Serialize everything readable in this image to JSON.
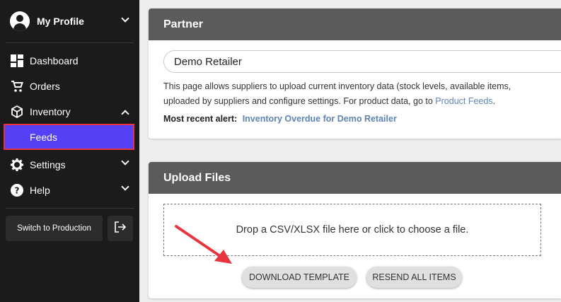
{
  "sidebar": {
    "profile_label": "My Profile",
    "nav": {
      "dashboard": "Dashboard",
      "orders": "Orders",
      "inventory": "Inventory",
      "feeds": "Feeds",
      "settings": "Settings",
      "help": "Help"
    },
    "switch_label": "Switch to Production"
  },
  "partner": {
    "header": "Partner",
    "selected": "Demo Retailer",
    "desc_line1": "This page allows suppliers to upload current inventory data (stock levels, available items,",
    "desc_line2": "uploaded by suppliers and configure settings. For product data, go to",
    "desc_link": "Product Feeds",
    "desc_end": ".",
    "alert_label": "Most recent alert:",
    "alert_link": "Inventory Overdue for Demo Retailer"
  },
  "upload": {
    "header": "Upload Files",
    "dropzone_text": "Drop a CSV/XLSX file here or click to choose a file.",
    "download_label": "DOWNLOAD TEMPLATE",
    "resend_label": "RESEND ALL ITEMS"
  },
  "colors": {
    "sidebar_bg": "#1b1b1b",
    "feeds_active": "#5540f6",
    "highlight_border": "#e8343f",
    "card_header": "#5b5b5b",
    "link": "#5d84b6",
    "annotation_arrow": "#e8343f"
  },
  "icons": {
    "profile": "account-circle-icon",
    "dashboard": "dashboard-icon",
    "orders": "cart-icon",
    "inventory": "box-icon",
    "settings": "gear-icon",
    "help": "help-circle-icon",
    "logout": "logout-icon"
  }
}
